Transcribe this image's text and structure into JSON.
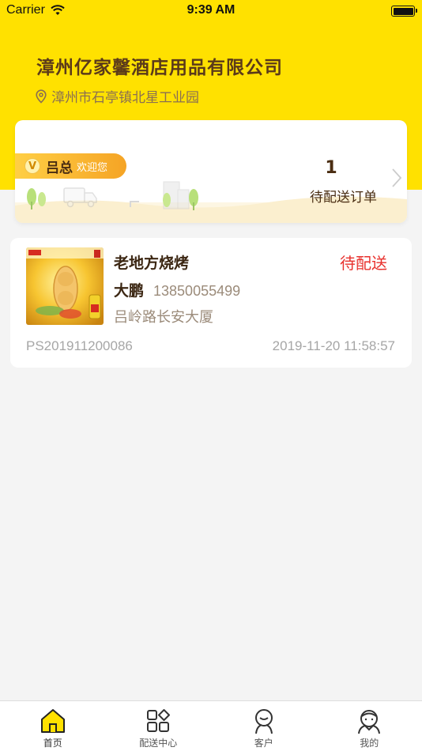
{
  "status_bar": {
    "carrier": "Carrier",
    "time": "9:39 AM"
  },
  "header": {
    "company_name": "漳州亿家馨酒店用品有限公司",
    "address": "漳州市石亭镇北星工业园",
    "background_color": "#ffe100"
  },
  "welcome_card": {
    "badge_letter": "V",
    "user_name": "吕总",
    "greeting": "欢迎您",
    "pending_count": "1",
    "pending_label": "待配送订单"
  },
  "orders": [
    {
      "shop_name": "老地方烧烤",
      "status": "待配送",
      "customer_name": "大鹏",
      "customer_phone": "13850055499",
      "address": "吕岭路长安大厦",
      "order_no": "PS201911200086",
      "time": "2019-11-20 11:58:57",
      "status_color": "#e8312d"
    }
  ],
  "tabbar": {
    "items": [
      {
        "label": "首页",
        "icon": "home-icon",
        "active": true
      },
      {
        "label": "配送中心",
        "icon": "delivery-center-icon",
        "active": false
      },
      {
        "label": "客户",
        "icon": "customer-icon",
        "active": false
      },
      {
        "label": "我的",
        "icon": "profile-icon",
        "active": false
      }
    ]
  }
}
